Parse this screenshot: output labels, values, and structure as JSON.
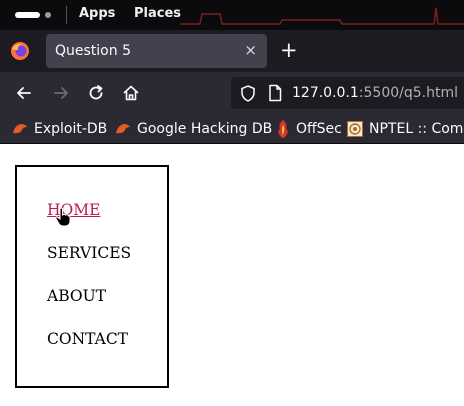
{
  "os_bar": {
    "menus": [
      "Apps",
      "Places"
    ]
  },
  "browser": {
    "tab": {
      "title": "Question 5",
      "close_glyph": "×"
    },
    "new_tab_glyph": "+",
    "url": {
      "host": "127.0.0.1",
      "rest": ":5500/q5.html"
    },
    "bookmarks": [
      {
        "label": "Exploit-DB",
        "icon": "exploit-db-icon"
      },
      {
        "label": "Google Hacking DB",
        "icon": "ghdb-icon"
      },
      {
        "label": "OffSec",
        "icon": "offsec-icon"
      },
      {
        "label": "NPTEL :: Comp",
        "icon": "nptel-icon"
      }
    ],
    "colors": {
      "tab_active": "#42414d",
      "toolbar": "#2b2a33",
      "tabbar": "#1c1b22"
    }
  },
  "page": {
    "menu": [
      {
        "label": "HOME",
        "state": "hover"
      },
      {
        "label": "SERVICES",
        "state": "normal"
      },
      {
        "label": "ABOUT",
        "state": "normal"
      },
      {
        "label": "CONTACT",
        "state": "normal"
      }
    ],
    "hover_color": "#c2185b"
  }
}
